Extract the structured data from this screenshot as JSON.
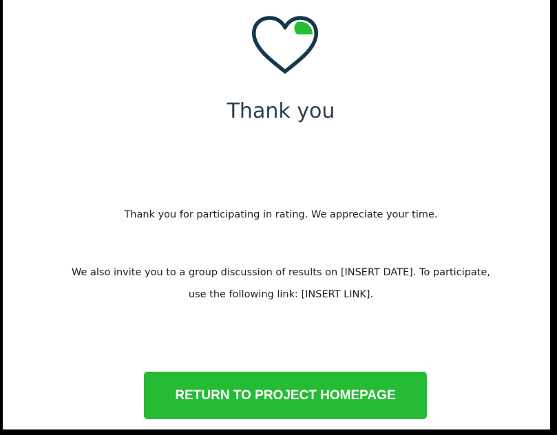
{
  "page": {
    "title": "Thank you",
    "message_1": "Thank you for participating in rating. We appreciate your time.",
    "message_2_line_1": "We also invite you to a group discussion of results on [INSERT DATE]. To participate,",
    "message_2_line_2": "use the following link: [INSERT LINK].",
    "button_label": "RETURN TO PROJECT HOMEPAGE"
  },
  "icons": {
    "heart": "heart-icon"
  },
  "colors": {
    "accent_green": "#26bb35",
    "heart_outline": "#14384a",
    "title_text": "#2d3d4d",
    "body_text": "#1f1f1f",
    "frame_border": "#000000"
  }
}
